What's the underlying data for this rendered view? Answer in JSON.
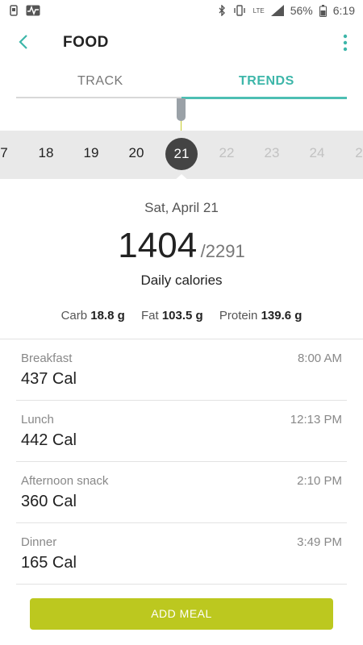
{
  "status_bar": {
    "battery": "56%",
    "time": "6:19",
    "network": "LTE"
  },
  "header": {
    "title": "FOOD"
  },
  "tabs": [
    {
      "label": "TRACK",
      "active": false
    },
    {
      "label": "TRENDS",
      "active": true
    }
  ],
  "date_strip": {
    "days": [
      "7",
      "18",
      "19",
      "20",
      "21",
      "22",
      "23",
      "24",
      "2"
    ],
    "selected": "21"
  },
  "summary": {
    "date": "Sat, April 21",
    "consumed": "1404",
    "goal": "/2291",
    "caption": "Daily calories",
    "macros": [
      {
        "label": "Carb",
        "value": "18.8 g"
      },
      {
        "label": "Fat",
        "value": "103.5 g"
      },
      {
        "label": "Protein",
        "value": "139.6 g"
      }
    ]
  },
  "meals": [
    {
      "name": "Breakfast",
      "calories": "437 Cal",
      "time": "8:00 AM"
    },
    {
      "name": "Lunch",
      "calories": "442 Cal",
      "time": "12:13 PM"
    },
    {
      "name": "Afternoon snack",
      "calories": "360 Cal",
      "time": "2:10 PM"
    },
    {
      "name": "Dinner",
      "calories": "165 Cal",
      "time": "3:49 PM"
    }
  ],
  "actions": {
    "add_meal": "ADD MEAL"
  },
  "colors": {
    "accent_teal": "#3db6a9",
    "button_lime": "#bcc81f",
    "date_strip_bg": "#e9e9e9"
  }
}
